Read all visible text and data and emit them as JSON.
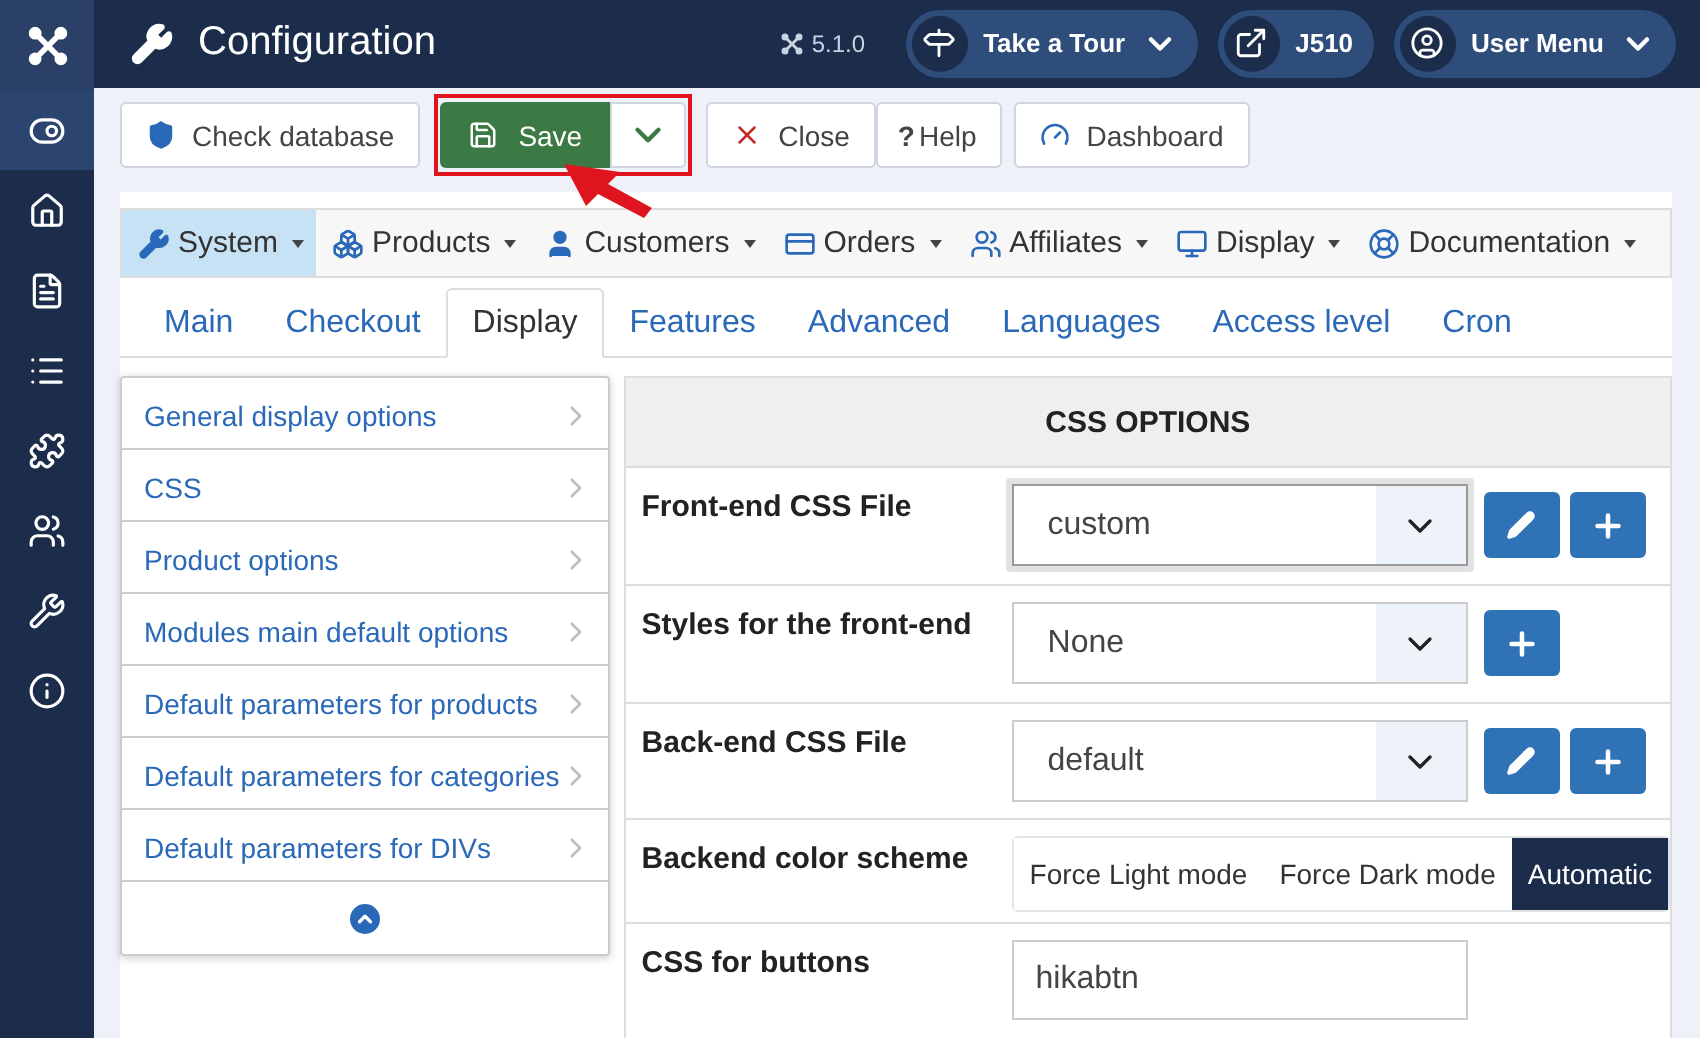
{
  "header": {
    "title": "Configuration",
    "version": "5.1.0",
    "pills": [
      {
        "label": "Take a Tour",
        "dropdown": true
      },
      {
        "label": "J510",
        "dropdown": false
      },
      {
        "label": "User Menu",
        "dropdown": true
      }
    ]
  },
  "sidebar": {
    "items": [
      {
        "selected": true
      },
      {
        "selected": false
      },
      {
        "selected": false
      },
      {
        "selected": false
      },
      {
        "selected": false
      },
      {
        "selected": false
      },
      {
        "selected": false
      },
      {
        "selected": false
      }
    ]
  },
  "toolbar": {
    "buttons": [
      {
        "kind": "plain",
        "label": "Check database"
      },
      {
        "kind": "split",
        "label": "Save",
        "highlighted": true
      },
      {
        "kind": "plain",
        "label": "Close"
      },
      {
        "kind": "plain",
        "label": "Help",
        "prefix": "?"
      },
      {
        "kind": "plain",
        "label": "Dashboard"
      }
    ]
  },
  "menu": {
    "items": [
      {
        "label": "System",
        "selected": true
      },
      {
        "label": "Products",
        "selected": false
      },
      {
        "label": "Customers",
        "selected": false
      },
      {
        "label": "Orders",
        "selected": false
      },
      {
        "label": "Affiliates",
        "selected": false
      },
      {
        "label": "Display",
        "selected": false
      },
      {
        "label": "Documentation",
        "selected": false
      }
    ]
  },
  "tabs": [
    {
      "label": "Main",
      "selected": false
    },
    {
      "label": "Checkout",
      "selected": false
    },
    {
      "label": "Display",
      "selected": true
    },
    {
      "label": "Features",
      "selected": false
    },
    {
      "label": "Advanced",
      "selected": false
    },
    {
      "label": "Languages",
      "selected": false
    },
    {
      "label": "Access level",
      "selected": false
    },
    {
      "label": "Cron",
      "selected": false
    }
  ],
  "section_list": {
    "items": [
      "General display options",
      "CSS",
      "Product options",
      "Modules main default options",
      "Default parameters for products",
      "Default parameters for categories",
      "Default parameters for DIVs"
    ]
  },
  "panel": {
    "title": "CSS OPTIONS",
    "rows": [
      {
        "kind": "select",
        "label": "Front-end CSS File",
        "value": "custom",
        "focused": true,
        "buttons": [
          {
            "kind": "edit"
          },
          {
            "kind": "add"
          }
        ]
      },
      {
        "kind": "select",
        "label": "Styles for the front-end",
        "value": "None",
        "focused": false,
        "buttons": [
          {
            "kind": "add"
          }
        ]
      },
      {
        "kind": "select",
        "label": "Back-end CSS File",
        "value": "default",
        "focused": false,
        "buttons": [
          {
            "kind": "edit"
          },
          {
            "kind": "add"
          }
        ]
      },
      {
        "kind": "segmented",
        "label": "Backend color scheme",
        "options": [
          {
            "label": "Force Light mode",
            "selected": false
          },
          {
            "label": "Force Dark mode",
            "selected": false
          },
          {
            "label": "Automatic",
            "selected": true
          }
        ]
      },
      {
        "kind": "text",
        "label": "CSS for buttons",
        "value": "hikabtn"
      }
    ]
  }
}
